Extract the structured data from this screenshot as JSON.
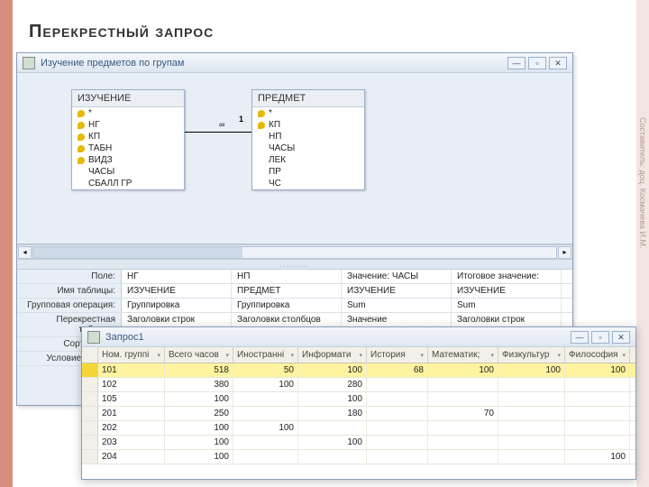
{
  "title": "Перекрестный запрос",
  "credit": "Составитель: доц. Космачева И.М.",
  "win1": {
    "title": "Изучение предметов по групам",
    "btn_min": "—",
    "btn_max": "▫",
    "btn_close": "✕",
    "tables": {
      "t1": {
        "name": "ИЗУЧЕНИЕ",
        "fields": [
          {
            "k": true,
            "n": "*"
          },
          {
            "k": true,
            "n": "НГ"
          },
          {
            "k": true,
            "n": "КП"
          },
          {
            "k": true,
            "n": "ТАБН"
          },
          {
            "k": true,
            "n": "ВИДЗ"
          },
          {
            "k": false,
            "n": "ЧАСЫ"
          },
          {
            "k": false,
            "n": "СБАЛЛ ГР"
          }
        ]
      },
      "t2": {
        "name": "ПРЕДМЕТ",
        "fields": [
          {
            "k": true,
            "n": "*"
          },
          {
            "k": true,
            "n": "КП"
          },
          {
            "k": false,
            "n": "НП"
          },
          {
            "k": false,
            "n": "ЧАСЫ"
          },
          {
            "k": false,
            "n": "ЛЕК"
          },
          {
            "k": false,
            "n": "ПР"
          },
          {
            "k": false,
            "n": "ЧС"
          }
        ]
      }
    },
    "rel": {
      "left_label": "∞",
      "right_label": "1"
    },
    "grid": {
      "labels": {
        "field": "Поле:",
        "table": "Имя таблицы:",
        "total": "Групповая операция:",
        "crosstab": "Перекрестная таблица:",
        "sort": "Сортировка:",
        "criteria": "Условие отбора:"
      },
      "cols": [
        {
          "field": "НГ",
          "table": "ИЗУЧЕНИЕ",
          "total": "Группировка",
          "crosstab": "Заголовки строк",
          "sort": "",
          "criteria": ""
        },
        {
          "field": "НП",
          "table": "ПРЕДМЕТ",
          "total": "Группировка",
          "crosstab": "Заголовки столбцов",
          "sort": "",
          "criteria": ""
        },
        {
          "field": "Значение: ЧАСЫ",
          "table": "ИЗУЧЕНИЕ",
          "total": "Sum",
          "crosstab": "Значение",
          "sort": "",
          "criteria": ""
        },
        {
          "field": "Итоговое значение:",
          "table": "ИЗУЧЕНИЕ",
          "total": "Sum",
          "crosstab": "Заголовки строк",
          "sort": "",
          "criteria": ""
        }
      ]
    }
  },
  "win2": {
    "title": "Запрос1",
    "btn_min": "—",
    "btn_max": "▫",
    "btn_close": "✕",
    "columns": [
      "Ном. группі",
      "Всего часов",
      "Иностранні",
      "Информати",
      "История",
      "Математик;",
      "Физкультур",
      "Философия"
    ],
    "rows": [
      {
        "sel": true,
        "cells": [
          "101",
          "518",
          "50",
          "100",
          "68",
          "100",
          "100",
          "100"
        ]
      },
      {
        "sel": false,
        "cells": [
          "102",
          "380",
          "100",
          "280",
          "",
          "",
          "",
          ""
        ]
      },
      {
        "sel": false,
        "cells": [
          "105",
          "100",
          "",
          "100",
          "",
          "",
          "",
          ""
        ]
      },
      {
        "sel": false,
        "cells": [
          "201",
          "250",
          "",
          "180",
          "",
          "70",
          "",
          ""
        ]
      },
      {
        "sel": false,
        "cells": [
          "202",
          "100",
          "100",
          "",
          "",
          "",
          "",
          ""
        ]
      },
      {
        "sel": false,
        "cells": [
          "203",
          "100",
          "",
          "100",
          "",
          "",
          "",
          ""
        ]
      },
      {
        "sel": false,
        "cells": [
          "204",
          "100",
          "",
          "",
          "",
          "",
          "",
          "100"
        ]
      }
    ]
  }
}
